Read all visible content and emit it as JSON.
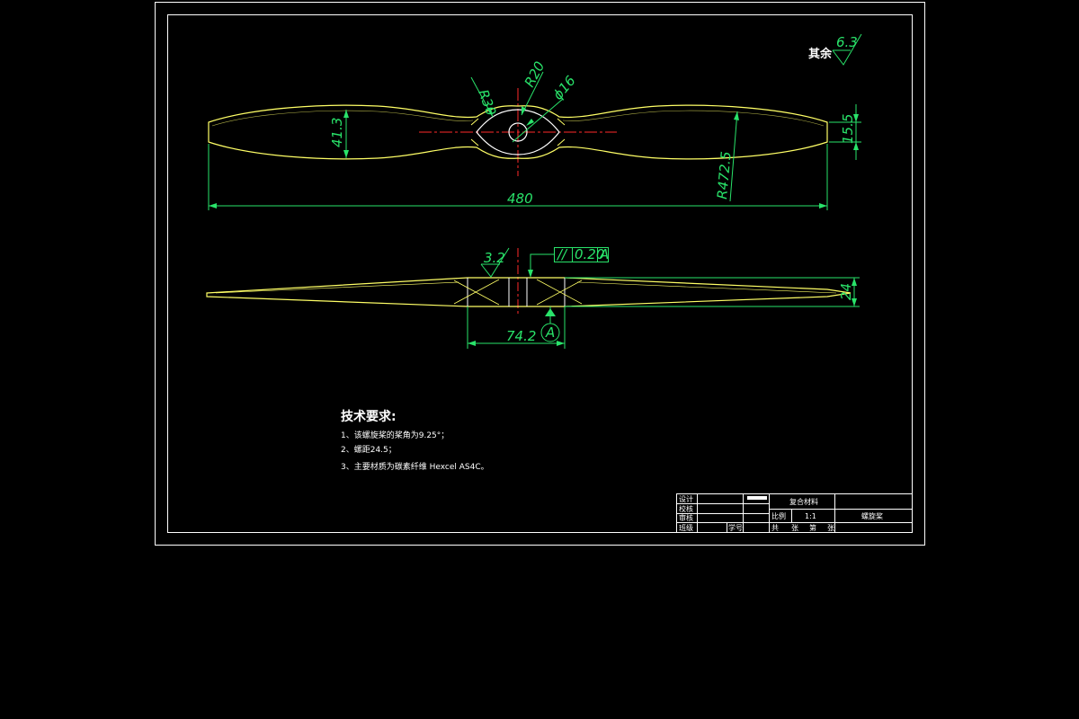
{
  "drawing": {
    "surface_roughness": {
      "label": "其余",
      "value": "6.3"
    },
    "top_view": {
      "dims": {
        "r30": "R30",
        "r20": "R20",
        "phi16": "ϕ16",
        "h41_3": "41.3",
        "h15_5": "15.5",
        "r472_5": "R472.5",
        "len480": "480"
      }
    },
    "side_view": {
      "roughness": "3.2",
      "tolerance": {
        "symbol": "//",
        "value": "0.20",
        "datum": "A"
      },
      "dims": {
        "h24": "24",
        "len74_2": "74.2",
        "datum_label": "A"
      }
    },
    "notes": {
      "title": "技术要求:",
      "items": [
        "1、该螺旋桨的桨角为9.25°；",
        "2、螺距24.5；",
        "3、主要材质为碳素纤维 Hexcel AS4C。"
      ]
    },
    "title_block": {
      "row_labels": [
        "设计",
        "校核",
        "审核",
        "班级"
      ],
      "student_id_label": "学号",
      "material": "复合材料",
      "scale_label": "比例",
      "scale_value": "1:1",
      "part_name": "螺旋桨",
      "sheet_info": [
        "共",
        "张",
        "第",
        "张"
      ]
    }
  },
  "colors": {
    "background": "#000000",
    "frame": "#ffffff",
    "outline": "#ffff66",
    "dimension": "#29e36a",
    "centerline": "#ff2a2a",
    "text": "#ffffff"
  }
}
